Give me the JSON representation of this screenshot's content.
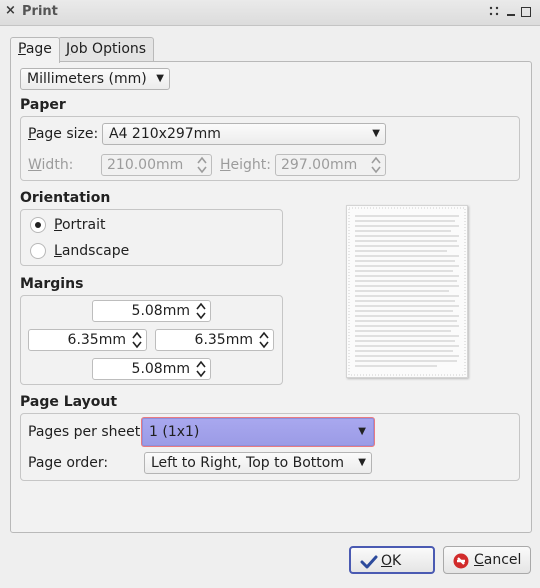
{
  "window": {
    "title": "Print",
    "close_glyph": "×"
  },
  "tabs": [
    {
      "label_key": "P",
      "label_rest": "age",
      "active": true
    },
    {
      "label_key": "J",
      "label_rest": "ob Options",
      "active": false
    }
  ],
  "units": {
    "value": "Millimeters (mm)"
  },
  "paper": {
    "section_title": "Paper",
    "page_size_label_key": "P",
    "page_size_label_rest": "age size:",
    "page_size_value": "A4 210x297mm",
    "width_label_key": "W",
    "width_label_rest": "idth:",
    "width_value": "210.00mm",
    "height_label_key": "H",
    "height_label_rest": "eight:",
    "height_value": "297.00mm"
  },
  "orientation": {
    "section_title": "Orientation",
    "portrait_key": "P",
    "portrait_rest": "ortrait",
    "landscape_key": "L",
    "landscape_rest": "andscape",
    "selected": "portrait"
  },
  "margins": {
    "section_title": "Margins",
    "top": "5.08mm",
    "left": "6.35mm",
    "right": "6.35mm",
    "bottom": "5.08mm"
  },
  "page_layout": {
    "section_title": "Page Layout",
    "pages_per_sheet_label": "Pages per sheet:",
    "pages_per_sheet_value": "1 (1x1)",
    "page_order_label": "Page order:",
    "page_order_value": "Left to Right, Top to Bottom"
  },
  "buttons": {
    "ok_key": "O",
    "ok_rest": "K",
    "cancel_key": "C",
    "cancel_rest": "ancel"
  },
  "icons": {
    "close": "close-icon",
    "dropdown": "chevron-down-icon",
    "spinner": "spinner-arrows-icon",
    "ok": "checkmark-icon",
    "cancel": "cancel-icon",
    "preview": "page-preview"
  },
  "colors": {
    "highlight": "#9b9be6",
    "highlight_border": "#e87b82",
    "ok_icon": "#2c4a9c",
    "cancel_icon": "#d12b2b"
  }
}
